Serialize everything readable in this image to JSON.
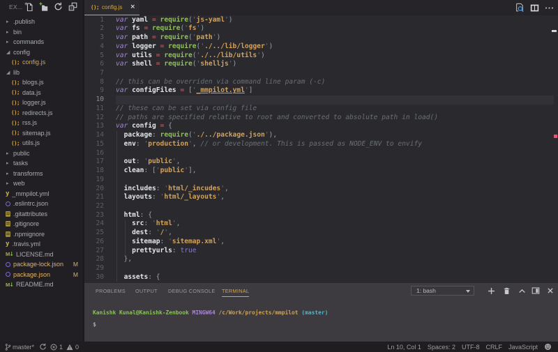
{
  "colors": {
    "accent_gold": "#d7a841",
    "modified_gold": "#ddb46a",
    "sidebar_bg": "#221f24",
    "editor_bg": "#2a2a2e",
    "panel_bg": "#3e3b40",
    "statusbar_bg": "#201d21",
    "error_red": "#e8506b"
  },
  "sidebar": {
    "header": {
      "label": "EX...",
      "icons": [
        "new-file-icon",
        "new-folder-icon",
        "refresh-icon",
        "collapse-all-icon"
      ]
    },
    "tree": [
      {
        "kind": "folder",
        "label": ".publish",
        "expanded": false
      },
      {
        "kind": "folder",
        "label": "bin",
        "expanded": false
      },
      {
        "kind": "folder",
        "label": "commands",
        "expanded": false
      },
      {
        "kind": "folder",
        "label": "config",
        "expanded": true
      },
      {
        "kind": "file",
        "label": "config.js",
        "icon": "js",
        "depth": 1,
        "selected": true
      },
      {
        "kind": "folder",
        "label": "lib",
        "expanded": true
      },
      {
        "kind": "file",
        "label": "blogs.js",
        "icon": "js",
        "depth": 1
      },
      {
        "kind": "file",
        "label": "data.js",
        "icon": "js",
        "depth": 1
      },
      {
        "kind": "file",
        "label": "logger.js",
        "icon": "js",
        "depth": 1
      },
      {
        "kind": "file",
        "label": "redirects.js",
        "icon": "js",
        "depth": 1
      },
      {
        "kind": "file",
        "label": "rss.js",
        "icon": "js",
        "depth": 1
      },
      {
        "kind": "file",
        "label": "sitemap.js",
        "icon": "js",
        "depth": 1
      },
      {
        "kind": "file",
        "label": "utils.js",
        "icon": "js",
        "depth": 1
      },
      {
        "kind": "folder",
        "label": "public",
        "expanded": false
      },
      {
        "kind": "folder",
        "label": "tasks",
        "expanded": false
      },
      {
        "kind": "folder",
        "label": "transforms",
        "expanded": false
      },
      {
        "kind": "folder",
        "label": "web",
        "expanded": false
      },
      {
        "kind": "file",
        "label": "_mmpilot.yml",
        "icon": "yaml",
        "depth": 0
      },
      {
        "kind": "file",
        "label": ".eslintrc.json",
        "icon": "ring",
        "depth": 0
      },
      {
        "kind": "file",
        "label": ".gitattributes",
        "icon": "git",
        "depth": 0
      },
      {
        "kind": "file",
        "label": ".gitignore",
        "icon": "git",
        "depth": 0
      },
      {
        "kind": "file",
        "label": ".npmignore",
        "icon": "git",
        "depth": 0
      },
      {
        "kind": "file",
        "label": ".travis.yml",
        "icon": "yaml",
        "depth": 0
      },
      {
        "kind": "file",
        "label": "LICENSE.md",
        "icon": "md",
        "depth": 0
      },
      {
        "kind": "file",
        "label": "package-lock.json",
        "icon": "ring",
        "depth": 0,
        "modified": true,
        "badge": "M"
      },
      {
        "kind": "file",
        "label": "package.json",
        "icon": "ring",
        "depth": 0,
        "modified": true,
        "badge": "M"
      },
      {
        "kind": "file",
        "label": "README.md",
        "icon": "md",
        "depth": 0
      }
    ],
    "chevron_expanded": "◢",
    "chevron_collapsed": "▸"
  },
  "editor": {
    "tab": {
      "icon_glyph": "();",
      "label": "config.js",
      "close_glyph": "×"
    },
    "title_icons": [
      "open-preview-icon",
      "split-editor-icon",
      "more-actions-icon"
    ],
    "current_line": 10,
    "cursor": "Ln 10, Col 1",
    "lines": [
      [
        {
          "c": "kw",
          "t": "var "
        },
        {
          "c": "id",
          "t": "yaml"
        },
        {
          "c": "op",
          "t": " = "
        },
        {
          "c": "fn",
          "t": "require"
        },
        {
          "c": "pu",
          "t": "("
        },
        {
          "c": "q",
          "t": "'"
        },
        {
          "c": "st",
          "t": "js-yaml"
        },
        {
          "c": "q",
          "t": "'"
        },
        {
          "c": "pu",
          "t": ")"
        }
      ],
      [
        {
          "c": "kw",
          "t": "var "
        },
        {
          "c": "id",
          "t": "fs"
        },
        {
          "c": "op",
          "t": " = "
        },
        {
          "c": "fn",
          "t": "require"
        },
        {
          "c": "pu",
          "t": "("
        },
        {
          "c": "q",
          "t": "'"
        },
        {
          "c": "st",
          "t": "fs"
        },
        {
          "c": "q",
          "t": "'"
        },
        {
          "c": "pu",
          "t": ")"
        }
      ],
      [
        {
          "c": "kw",
          "t": "var "
        },
        {
          "c": "id",
          "t": "path"
        },
        {
          "c": "op",
          "t": " = "
        },
        {
          "c": "fn",
          "t": "require"
        },
        {
          "c": "pu",
          "t": "("
        },
        {
          "c": "q",
          "t": "'"
        },
        {
          "c": "st",
          "t": "path"
        },
        {
          "c": "q",
          "t": "'"
        },
        {
          "c": "pu",
          "t": ")"
        }
      ],
      [
        {
          "c": "kw",
          "t": "var "
        },
        {
          "c": "id",
          "t": "logger"
        },
        {
          "c": "op",
          "t": " = "
        },
        {
          "c": "fn",
          "t": "require"
        },
        {
          "c": "pu",
          "t": "("
        },
        {
          "c": "q",
          "t": "'"
        },
        {
          "c": "st",
          "t": "./../lib/logger"
        },
        {
          "c": "q",
          "t": "'"
        },
        {
          "c": "pu",
          "t": ")"
        }
      ],
      [
        {
          "c": "kw",
          "t": "var "
        },
        {
          "c": "id",
          "t": "utils"
        },
        {
          "c": "op",
          "t": " = "
        },
        {
          "c": "fn",
          "t": "require"
        },
        {
          "c": "pu",
          "t": "("
        },
        {
          "c": "q",
          "t": "'"
        },
        {
          "c": "st",
          "t": "./../lib/utils"
        },
        {
          "c": "q",
          "t": "'"
        },
        {
          "c": "pu",
          "t": ")"
        }
      ],
      [
        {
          "c": "kw",
          "t": "var "
        },
        {
          "c": "id",
          "t": "shell"
        },
        {
          "c": "op",
          "t": " = "
        },
        {
          "c": "fn",
          "t": "require"
        },
        {
          "c": "pu",
          "t": "("
        },
        {
          "c": "q",
          "t": "'"
        },
        {
          "c": "st",
          "t": "shelljs"
        },
        {
          "c": "q",
          "t": "'"
        },
        {
          "c": "pu",
          "t": ")"
        }
      ],
      [],
      [
        {
          "c": "cm",
          "t": "// this can be overriden via command line param (-c)"
        }
      ],
      [
        {
          "c": "kw",
          "t": "var "
        },
        {
          "c": "id",
          "t": "configFiles"
        },
        {
          "c": "op",
          "t": " = "
        },
        {
          "c": "pu",
          "t": "["
        },
        {
          "c": "q",
          "t": "'"
        },
        {
          "c": "link",
          "t": "_mmpilot.yml"
        },
        {
          "c": "q",
          "t": "'"
        },
        {
          "c": "pu",
          "t": "]"
        }
      ],
      [],
      [
        {
          "c": "cm",
          "t": "// these can be set via config file"
        }
      ],
      [
        {
          "c": "cm",
          "t": "// paths are specified relative to root and converted to absolute path in load()"
        }
      ],
      [
        {
          "c": "kw",
          "t": "var "
        },
        {
          "c": "id",
          "t": "config"
        },
        {
          "c": "op",
          "t": " = "
        },
        {
          "c": "pu",
          "t": "{"
        }
      ],
      [
        {
          "c": "pu",
          "t": "  "
        },
        {
          "c": "key",
          "t": "package"
        },
        {
          "c": "pu",
          "t": ": "
        },
        {
          "c": "fn",
          "t": "require"
        },
        {
          "c": "pu",
          "t": "("
        },
        {
          "c": "q",
          "t": "'"
        },
        {
          "c": "st",
          "t": "./../package.json"
        },
        {
          "c": "q",
          "t": "'"
        },
        {
          "c": "pu",
          "t": "),"
        }
      ],
      [
        {
          "c": "pu",
          "t": "  "
        },
        {
          "c": "key",
          "t": "env"
        },
        {
          "c": "pu",
          "t": ": "
        },
        {
          "c": "q",
          "t": "'"
        },
        {
          "c": "st",
          "t": "production"
        },
        {
          "c": "q",
          "t": "'"
        },
        {
          "c": "pu",
          "t": ", "
        },
        {
          "c": "cm",
          "t": "// or development. This is passed as NODE_ENV to envify"
        }
      ],
      [],
      [
        {
          "c": "pu",
          "t": "  "
        },
        {
          "c": "key",
          "t": "out"
        },
        {
          "c": "pu",
          "t": ": "
        },
        {
          "c": "q",
          "t": "'"
        },
        {
          "c": "st",
          "t": "public"
        },
        {
          "c": "q",
          "t": "'"
        },
        {
          "c": "pu",
          "t": ","
        }
      ],
      [
        {
          "c": "pu",
          "t": "  "
        },
        {
          "c": "key",
          "t": "clean"
        },
        {
          "c": "pu",
          "t": ": ["
        },
        {
          "c": "q",
          "t": "'"
        },
        {
          "c": "st",
          "t": "public"
        },
        {
          "c": "q",
          "t": "'"
        },
        {
          "c": "pu",
          "t": "],"
        }
      ],
      [],
      [
        {
          "c": "pu",
          "t": "  "
        },
        {
          "c": "key",
          "t": "includes"
        },
        {
          "c": "pu",
          "t": ": "
        },
        {
          "c": "q",
          "t": "'"
        },
        {
          "c": "st",
          "t": "html/_incudes"
        },
        {
          "c": "q",
          "t": "'"
        },
        {
          "c": "pu",
          "t": ","
        }
      ],
      [
        {
          "c": "pu",
          "t": "  "
        },
        {
          "c": "key",
          "t": "layouts"
        },
        {
          "c": "pu",
          "t": ": "
        },
        {
          "c": "q",
          "t": "'"
        },
        {
          "c": "st",
          "t": "html/_layouts"
        },
        {
          "c": "q",
          "t": "'"
        },
        {
          "c": "pu",
          "t": ","
        }
      ],
      [],
      [
        {
          "c": "pu",
          "t": "  "
        },
        {
          "c": "key",
          "t": "html"
        },
        {
          "c": "pu",
          "t": ": {"
        }
      ],
      [
        {
          "c": "pu",
          "t": "    "
        },
        {
          "c": "key",
          "t": "src"
        },
        {
          "c": "pu",
          "t": ": "
        },
        {
          "c": "q",
          "t": "'"
        },
        {
          "c": "st",
          "t": "html"
        },
        {
          "c": "q",
          "t": "'"
        },
        {
          "c": "pu",
          "t": ","
        }
      ],
      [
        {
          "c": "pu",
          "t": "    "
        },
        {
          "c": "key",
          "t": "dest"
        },
        {
          "c": "pu",
          "t": ": "
        },
        {
          "c": "q",
          "t": "'"
        },
        {
          "c": "st",
          "t": "/"
        },
        {
          "c": "q",
          "t": "'"
        },
        {
          "c": "pu",
          "t": ","
        }
      ],
      [
        {
          "c": "pu",
          "t": "    "
        },
        {
          "c": "key",
          "t": "sitemap"
        },
        {
          "c": "pu",
          "t": ": "
        },
        {
          "c": "q",
          "t": "'"
        },
        {
          "c": "st",
          "t": "sitemap.xml"
        },
        {
          "c": "q",
          "t": "'"
        },
        {
          "c": "pu",
          "t": ","
        }
      ],
      [
        {
          "c": "pu",
          "t": "    "
        },
        {
          "c": "key",
          "t": "prettyurls"
        },
        {
          "c": "pu",
          "t": ": "
        },
        {
          "c": "bool",
          "t": "true"
        }
      ],
      [
        {
          "c": "pu",
          "t": "  },"
        }
      ],
      [],
      [
        {
          "c": "pu",
          "t": "  "
        },
        {
          "c": "key",
          "t": "assets"
        },
        {
          "c": "pu",
          "t": ": {"
        }
      ]
    ]
  },
  "panel": {
    "tabs": [
      {
        "label": "PROBLEMS",
        "active": false
      },
      {
        "label": "OUTPUT",
        "active": false
      },
      {
        "label": "DEBUG CONSOLE",
        "active": false
      },
      {
        "label": "TERMINAL",
        "active": true
      }
    ],
    "terminal_select": "1: bash",
    "icons": [
      "plus-icon",
      "trash-icon",
      "chevron-up-icon",
      "split-panel-icon",
      "close-icon"
    ],
    "terminal_lines": [
      [
        {
          "c": "tgreen",
          "t": "Kanishk Kunal@Kanishk-Zenbook "
        },
        {
          "c": "tviolet",
          "t": "MINGW64 "
        },
        {
          "c": "tgold",
          "t": "/c/Work/projects/mmpilot "
        },
        {
          "c": "tcyan",
          "t": "(master)"
        }
      ],
      [
        {
          "c": "",
          "t": "$"
        }
      ]
    ]
  },
  "statusbar": {
    "branch": "master*",
    "errors": "1",
    "warnings": "0",
    "right_items": [
      "Ln 10, Col 1",
      "Spaces: 2",
      "UTF-8",
      "CRLF",
      "JavaScript"
    ]
  }
}
